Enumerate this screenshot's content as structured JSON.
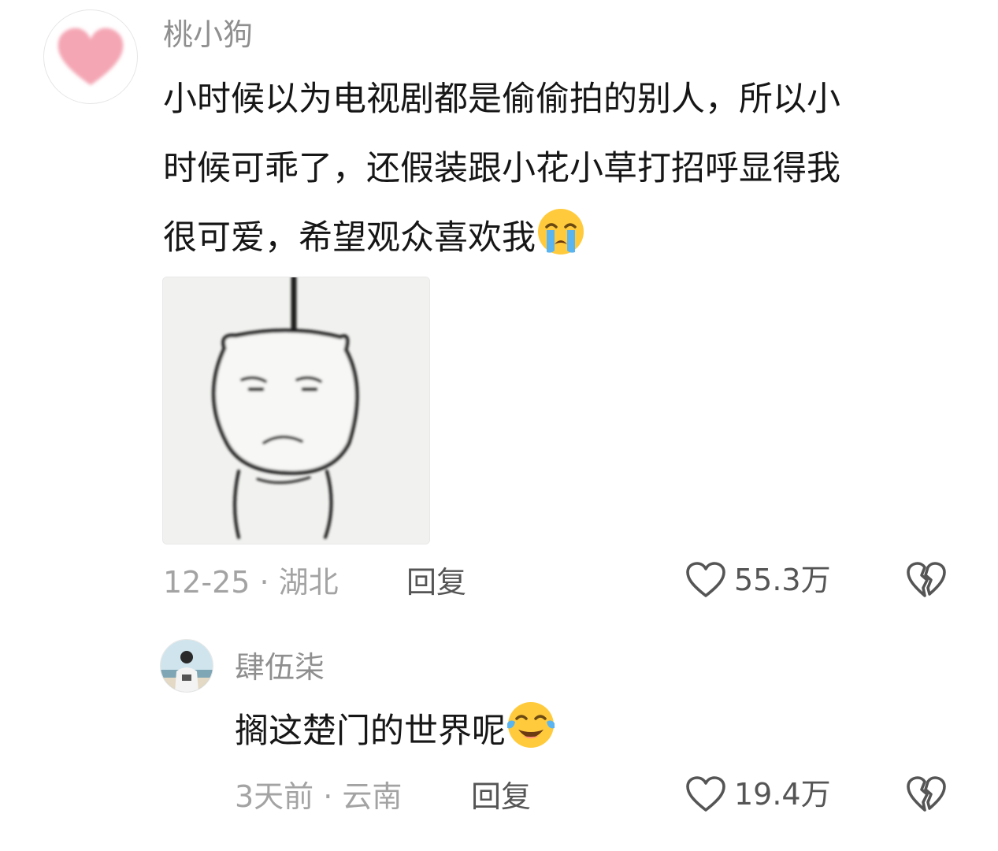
{
  "comment": {
    "username": "桃小狗",
    "text_lines": [
      "小时候以为电视剧都是偷偷拍的别人，所以小",
      "时候可乖了，还假装跟小花小草打招呼显得我",
      "很可爱，希望观众喜欢我"
    ],
    "emoji": "crying-face",
    "date_location": "12-25 · 湖北",
    "reply_label": "回复",
    "like_count": "55.3万",
    "avatar_icon": "pink-heart-icon",
    "attachment": "meme-sticker-image"
  },
  "reply": {
    "username": "肆伍柒",
    "text": "搁这楚门的世界呢",
    "emoji": "tears-of-joy-face",
    "date_location": "3天前 · 云南",
    "reply_label": "回复",
    "like_count": "19.4万"
  },
  "colors": {
    "username": "#8f8f8f",
    "text": "#161616",
    "meta": "#a3a3a3",
    "action": "#555555",
    "heart": "#f4a6b4"
  }
}
